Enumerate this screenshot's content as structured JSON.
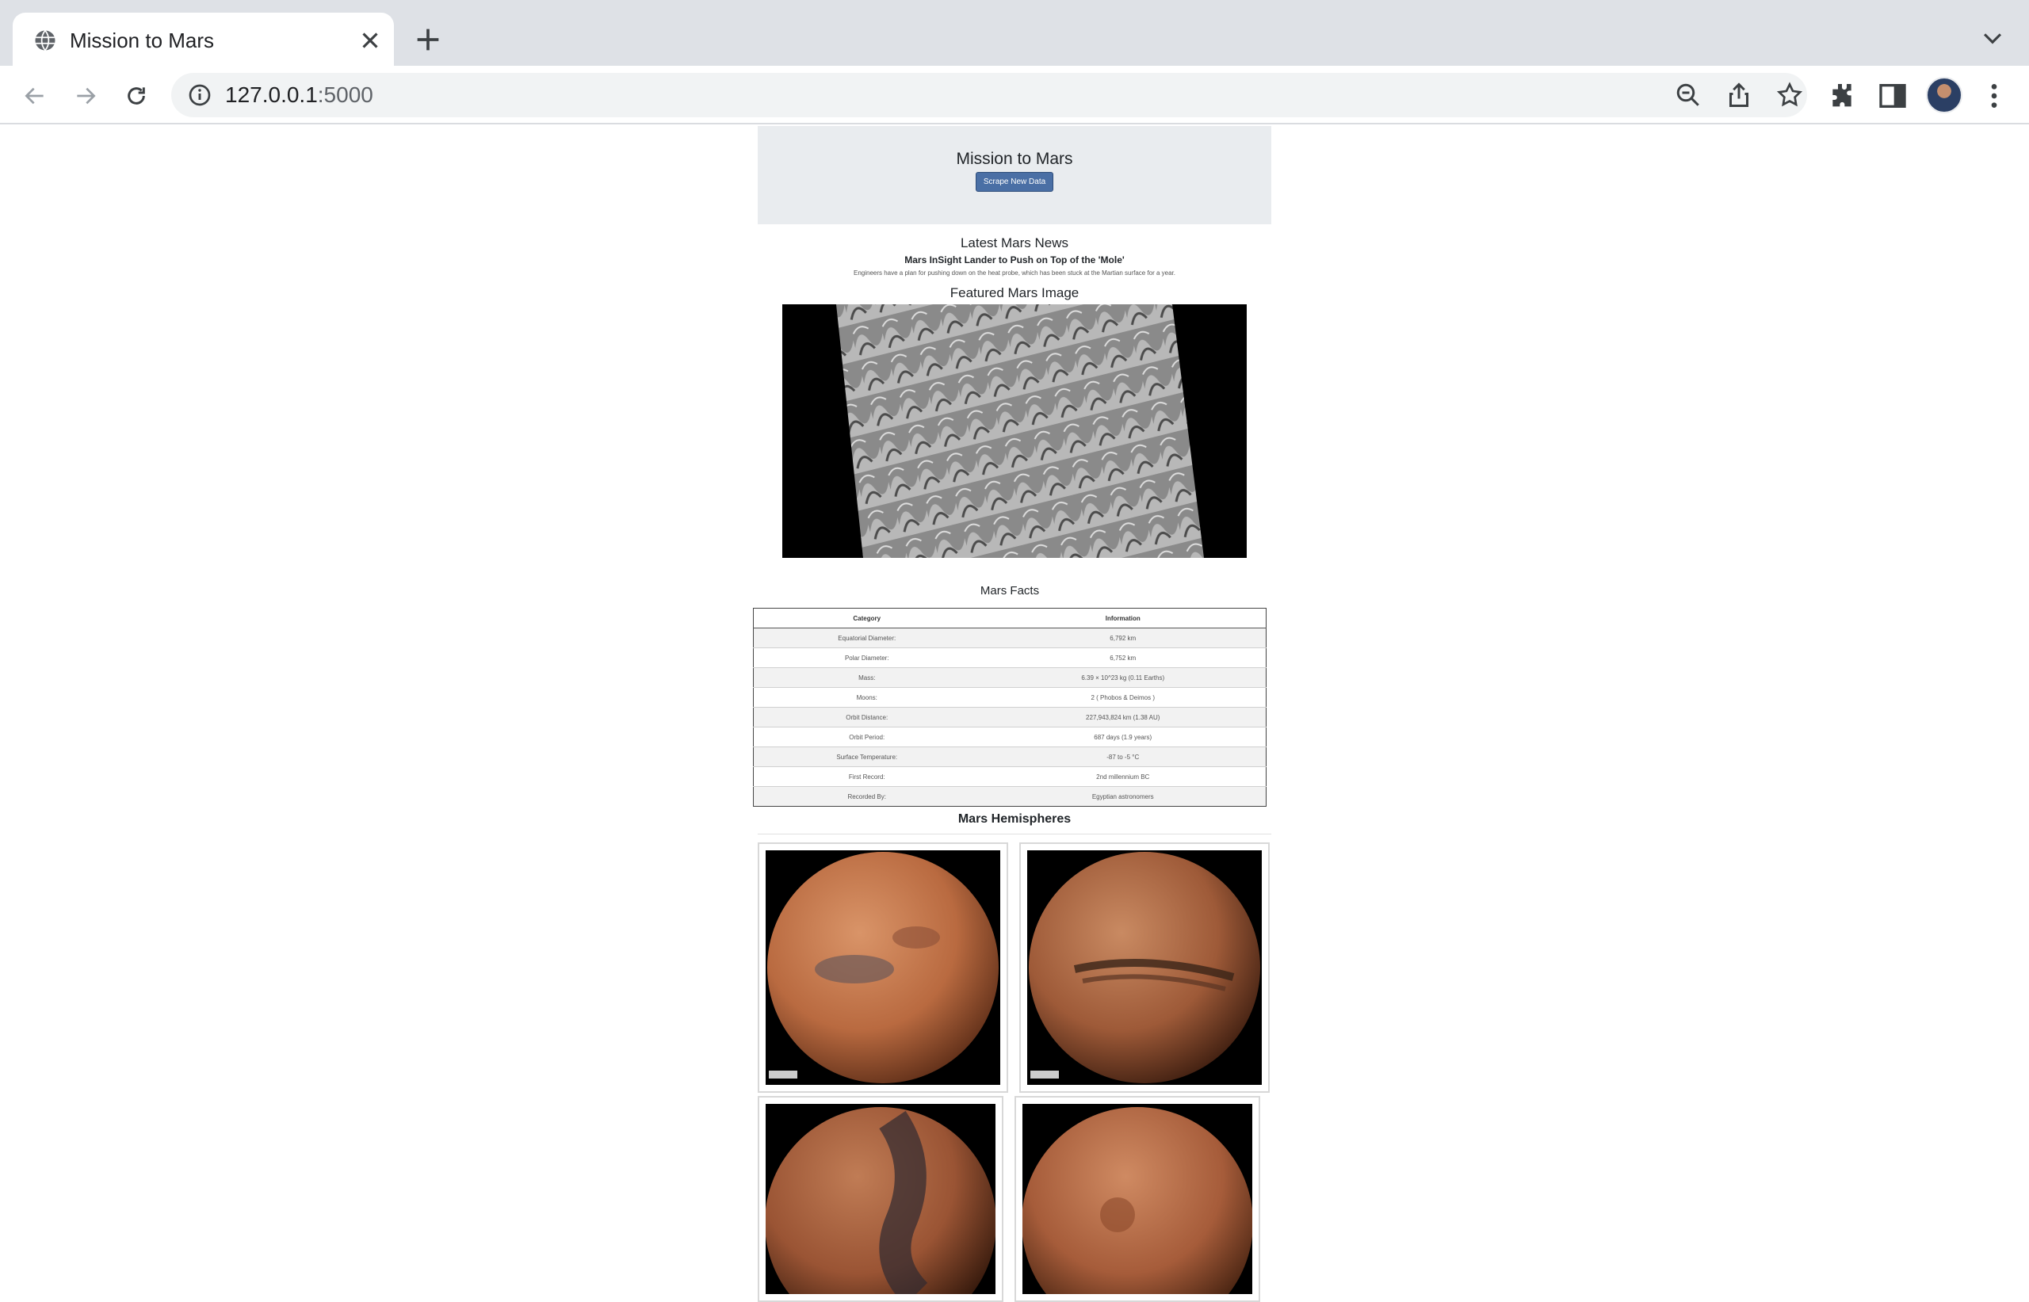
{
  "browser": {
    "tab_title": "Mission to Mars",
    "url_host": "127.0.0.1",
    "url_port": ":5000"
  },
  "header": {
    "title": "Mission to Mars",
    "scrape_button": "Scrape New Data"
  },
  "news": {
    "heading": "Latest Mars News",
    "title": "Mars InSight Lander to Push on Top of the 'Mole'",
    "paragraph": "Engineers have a plan for pushing down on the heat probe, which has been stuck at the Martian surface for a year."
  },
  "featured": {
    "heading": "Featured Mars Image"
  },
  "facts": {
    "heading": "Mars Facts",
    "columns": [
      "Category",
      "Information"
    ],
    "rows": [
      [
        "Equatorial Diameter:",
        "6,792 km"
      ],
      [
        "Polar Diameter:",
        "6,752 km"
      ],
      [
        "Mass:",
        "6.39 × 10^23 kg (0.11 Earths)"
      ],
      [
        "Moons:",
        "2 ( Phobos & Deimos )"
      ],
      [
        "Orbit Distance:",
        "227,943,824 km (1.38 AU)"
      ],
      [
        "Orbit Period:",
        "687 days (1.9 years)"
      ],
      [
        "Surface Temperature:",
        "-87 to -5 °C"
      ],
      [
        "First Record:",
        "2nd millennium BC"
      ],
      [
        "Recorded By:",
        "Egyptian astronomers"
      ]
    ]
  },
  "hemispheres": {
    "heading": "Mars Hemispheres"
  },
  "colors": {
    "accent_button": "#4a6fa5",
    "jumbotron": "#e9ecef",
    "chrome_tabstrip": "#dee1e6"
  }
}
